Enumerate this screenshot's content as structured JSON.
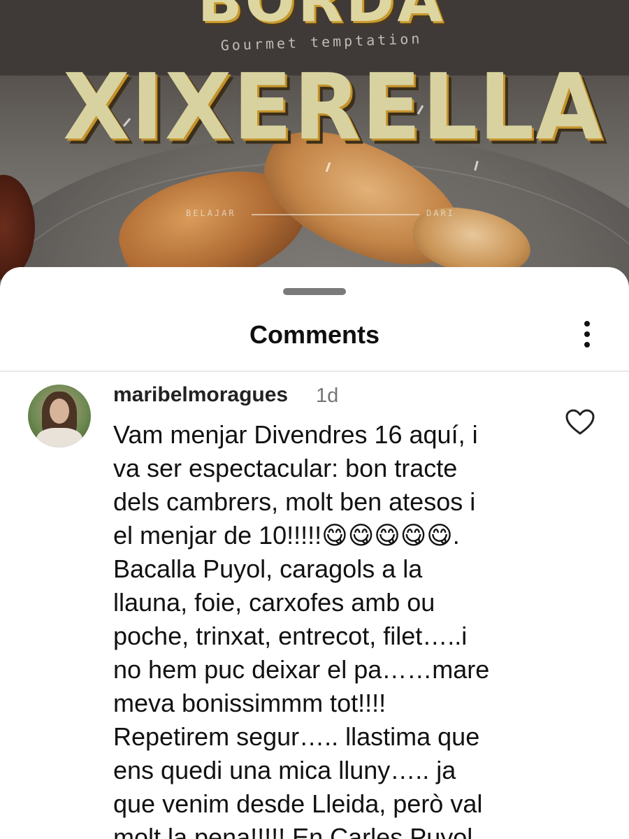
{
  "background": {
    "brand_top": "BORDA",
    "tagline": "Gourmet temptation",
    "brand_main": "XIXERELLA",
    "foot_left": "BELAJAR",
    "foot_right": "DARI"
  },
  "sheet": {
    "title": "Comments",
    "more_icon": "more-vertical-icon"
  },
  "comments": [
    {
      "username": "maribelmoragues",
      "time": "1d",
      "text": "Vam menjar Divendres 16 aquí, i\nva ser espectacular: bon tracte\ndels cambrers, molt ben atesos i\nel menjar de 10!!!!!😋😋😋😋😋.\nBacalla Puyol, caragols a la\nllauna, foie, carxofes amb ou\npoche, trinxat, entrecot, filet…..i\nno hem puc deixar el pa……mare\nmeva bonissimmm tot!!!!\nRepetirem segur….. llastima que\nens quedi una mica lluny….. ja\nque venim desde Lleida, però val\nmolt la pena!!!!! En Carles Puyol",
      "like_icon": "heart-outline-icon"
    }
  ],
  "colors": {
    "sheet_bg": "#ffffff",
    "text_primary": "#111111",
    "text_secondary": "#757575",
    "brand_yellow": "#d8d2a0"
  }
}
